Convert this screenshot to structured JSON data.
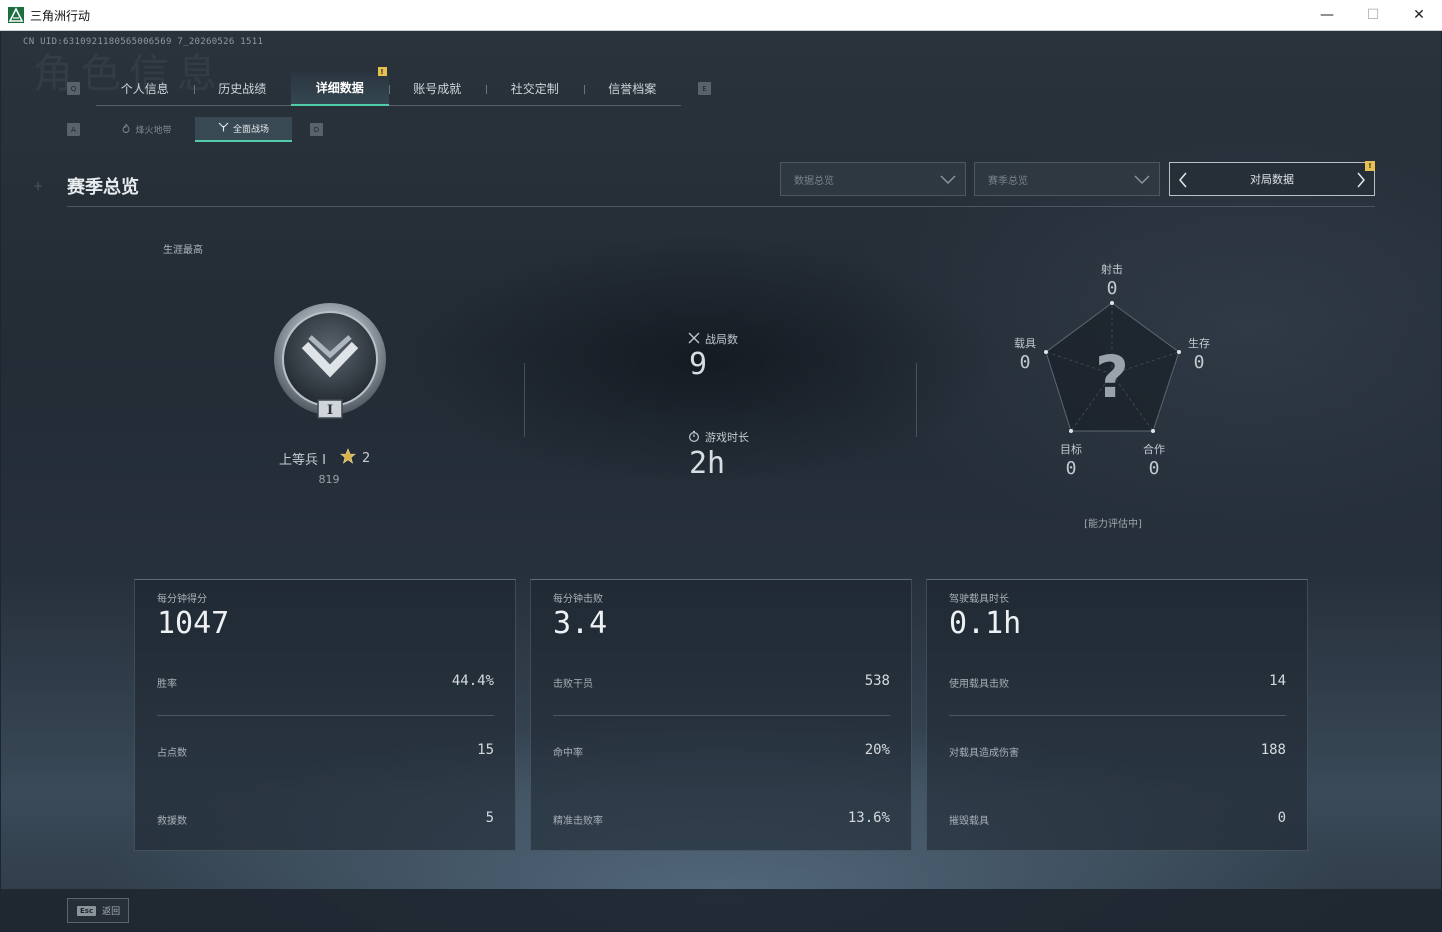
{
  "window": {
    "title": "三角洲行动",
    "min_glyph": "—",
    "max_glyph": "☐",
    "close_glyph": "✕"
  },
  "header": {
    "uid": "CN UID:6310921180565006569 7_20260526 1511",
    "watermark": "角色信息"
  },
  "keys": {
    "left_tab": "Q",
    "right_tab": "E",
    "left_sub": "A",
    "right_sub": "D",
    "tab_badge": "!",
    "pager_badge": "!"
  },
  "tabs": [
    {
      "label": "个人信息",
      "active": false
    },
    {
      "label": "历史战绩",
      "active": false
    },
    {
      "label": "详细数据",
      "active": true
    },
    {
      "label": "账号成就",
      "active": false
    },
    {
      "label": "社交定制",
      "active": false
    },
    {
      "label": "信誉档案",
      "active": false
    }
  ],
  "subtabs": [
    {
      "label": "烽火地带",
      "icon": "flame-icon",
      "active": false
    },
    {
      "label": "全面战场",
      "icon": "battlefield-icon",
      "active": true
    }
  ],
  "section": {
    "title": "赛季总览"
  },
  "filters": {
    "dropdown1": "数据总览",
    "dropdown2": "赛季总览",
    "pager_label": "对局数据"
  },
  "rank": {
    "career_label": "生涯最高",
    "name": "上等兵 I",
    "stars": "2",
    "points": "819",
    "emblem_roman": "I"
  },
  "overview": {
    "matches_label": "战局数",
    "matches_value": "9",
    "playtime_label": "游戏时长",
    "playtime_value": "2h"
  },
  "radar": {
    "center_mark": "?",
    "note": "[能力评估中]",
    "axes": [
      {
        "label": "射击",
        "value": "0"
      },
      {
        "label": "生存",
        "value": "0"
      },
      {
        "label": "合作",
        "value": "0"
      },
      {
        "label": "目标",
        "value": "0"
      },
      {
        "label": "载具",
        "value": "0"
      }
    ]
  },
  "cards": [
    {
      "title": "每分钟得分",
      "big": "1047",
      "rows": [
        {
          "label": "胜率",
          "value": "44.4%"
        },
        {
          "label": "占点数",
          "value": "15"
        },
        {
          "label": "救援数",
          "value": "5"
        }
      ]
    },
    {
      "title": "每分钟击败",
      "big": "3.4",
      "rows": [
        {
          "label": "击败干员",
          "value": "538"
        },
        {
          "label": "命中率",
          "value": "20%"
        },
        {
          "label": "精准击败率",
          "value": "13.6%"
        }
      ]
    },
    {
      "title": "驾驶载具时长",
      "big": "0.1h",
      "rows": [
        {
          "label": "使用载具击败",
          "value": "14"
        },
        {
          "label": "对载具造成伤害",
          "value": "188"
        },
        {
          "label": "摧毁载具",
          "value": "0"
        }
      ]
    }
  ],
  "footer": {
    "esc_key": "Esc",
    "back_label": "返回"
  },
  "colors": {
    "accent": "#52cba8",
    "badge": "#e7c150",
    "background": "#1e2530"
  }
}
